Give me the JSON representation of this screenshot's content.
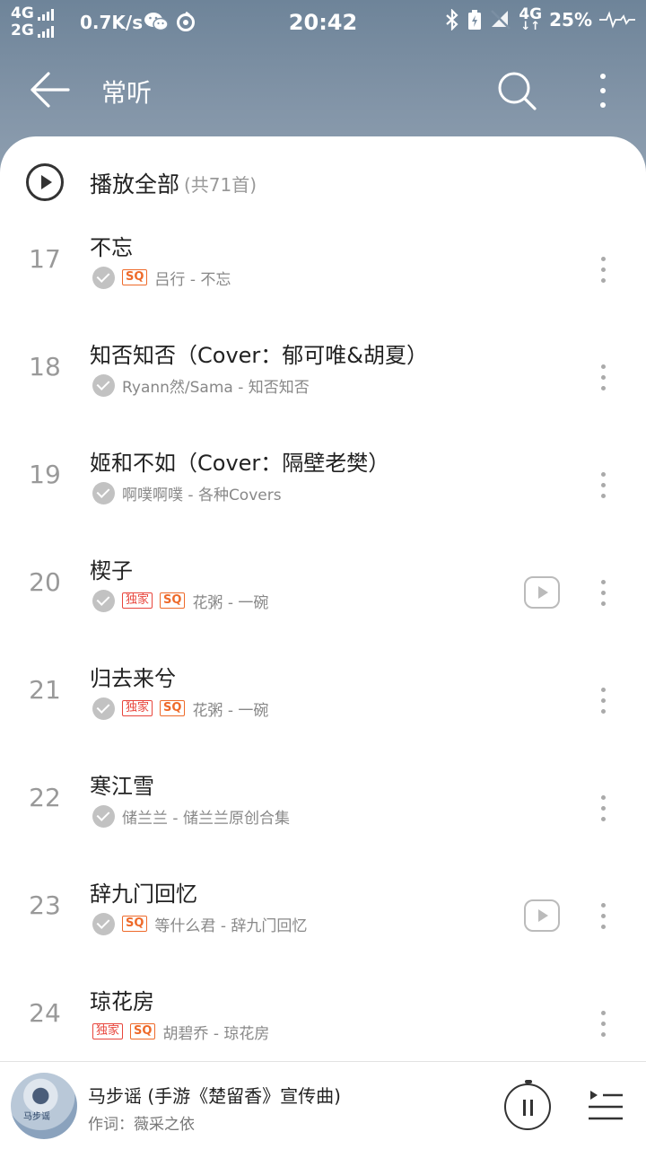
{
  "status_bar": {
    "net_top": "4G",
    "net_bottom": "2G",
    "speed": "0.7K/s",
    "time": "20:42",
    "net_type": "4G",
    "battery": "25%"
  },
  "header": {
    "title": "常听"
  },
  "play_all": {
    "label": "播放全部",
    "count": "(共71首)"
  },
  "songs": [
    {
      "num": "17",
      "title": "不忘",
      "exclusive": false,
      "sq": true,
      "checked": true,
      "mv": false,
      "meta": "吕行 - 不忘"
    },
    {
      "num": "18",
      "title": "知否知否（Cover：郁可唯&胡夏）",
      "exclusive": false,
      "sq": false,
      "checked": true,
      "mv": false,
      "meta": "Ryann然/Sama - 知否知否"
    },
    {
      "num": "19",
      "title": "姬和不如（Cover：隔壁老樊）",
      "exclusive": false,
      "sq": false,
      "checked": true,
      "mv": false,
      "meta": "啊噗啊噗 - 各种Covers"
    },
    {
      "num": "20",
      "title": "楔子",
      "exclusive": true,
      "sq": true,
      "checked": true,
      "mv": true,
      "meta": "花粥 - 一碗"
    },
    {
      "num": "21",
      "title": "归去来兮",
      "exclusive": true,
      "sq": true,
      "checked": true,
      "mv": false,
      "meta": "花粥 - 一碗"
    },
    {
      "num": "22",
      "title": "寒江雪",
      "exclusive": false,
      "sq": false,
      "checked": true,
      "mv": false,
      "meta": "储兰兰 - 储兰兰原创合集"
    },
    {
      "num": "23",
      "title": "辞九门回忆",
      "exclusive": false,
      "sq": true,
      "checked": true,
      "mv": true,
      "meta": "等什么君 - 辞九门回忆"
    },
    {
      "num": "24",
      "title": "琼花房",
      "exclusive": true,
      "sq": true,
      "checked": false,
      "mv": false,
      "meta": "胡碧乔 - 琼花房"
    }
  ],
  "badges": {
    "exclusive": "独家",
    "sq": "SQ"
  },
  "player": {
    "title": "马步谣 (手游《楚留香》宣传曲)",
    "subtitle": "作词：薇采之依",
    "cover_text": "马步谣"
  },
  "colors": {
    "header_bg": "#7d90a4",
    "badge_exclusive": "#e8453c",
    "badge_sq": "#ee6a2a"
  }
}
